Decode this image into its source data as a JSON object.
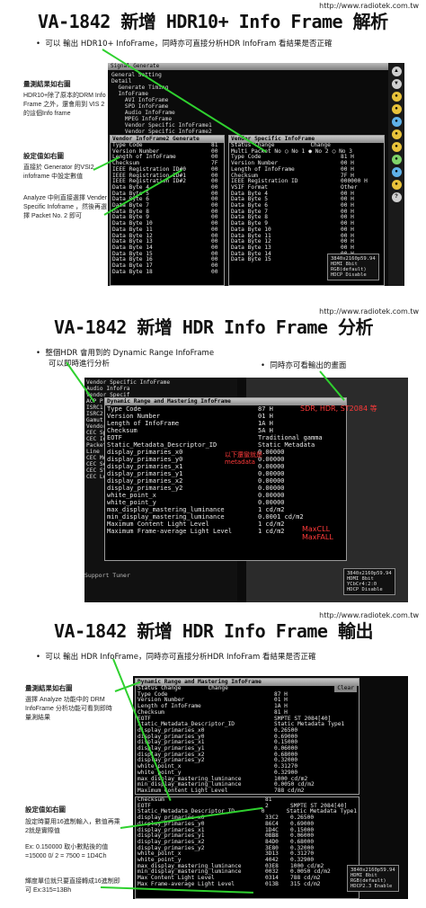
{
  "url": "http://www.radiotek.com.tw",
  "section1": {
    "title": "VA-1842 新增 HDR10+ Info Frame 解析",
    "bullet": "可以 輸出 HDR10+ InfoFrame，同時亦可直接分析HDR InfoFram 看結果是否正確",
    "side_head1": "量測結果如右圖",
    "side_text1": "HDR10+除了原本的DRM Info Frame 之外，還會用到 VIS 2 的這個Info frame",
    "side_head2": "設定值如右圖",
    "side_text2a": "直接於 Generator 的VSI2 infoframe 中設定數值",
    "side_text2b": "Analyze 中則直接選擇 Vender Specific Infoframe ，然後再選擇 Packet No. 2 即可",
    "window_title": "Signal Generate",
    "menu": [
      "General Setting",
      "Detail",
      "  Generate Timing",
      "  InfoFrame",
      "    AVI InfoFrame",
      "    SPD InfoFrame",
      "    Audio InfoFrame",
      "    MPEG InfoFrame",
      "    Vendor Specific InfoFrame1",
      "    Vendor Specific InfoFrame2"
    ],
    "left_pane": {
      "header": "Vendor InfoFrame2 Generate",
      "rows": [
        [
          "Type Code",
          "81"
        ],
        [
          "Version Number",
          "00"
        ],
        [
          "Length of InfoFrame",
          "00"
        ],
        [
          "Checksum",
          "7F"
        ],
        [
          "IEEE Registration ID#0",
          "00"
        ],
        [
          "IEEE Registration ID#1",
          "00"
        ],
        [
          "IEEE Registration ID#2",
          "00"
        ],
        [
          "Data Byte 4",
          "00"
        ],
        [
          "Data Byte 5",
          "00"
        ],
        [
          "Data Byte 6",
          "00"
        ],
        [
          "Data Byte 7",
          "00"
        ],
        [
          "Data Byte 8",
          "00"
        ],
        [
          "Data Byte 9",
          "00"
        ],
        [
          "Data Byte 10",
          "00"
        ],
        [
          "Data Byte 11",
          "00"
        ],
        [
          "Data Byte 12",
          "00"
        ],
        [
          "Data Byte 13",
          "00"
        ],
        [
          "Data Byte 14",
          "00"
        ],
        [
          "Data Byte 15",
          "00"
        ],
        [
          "Data Byte 16",
          "00"
        ],
        [
          "Data Byte 17",
          "00"
        ],
        [
          "Data Byte 18",
          "00"
        ]
      ]
    },
    "right_pane": {
      "header": "Vendor Specific InfoFrame",
      "status_change": "Status Change",
      "change": "Change",
      "multi_packet": "Multi Packet No",
      "no1": "No 1",
      "no2": "No 2",
      "no3": "No 3",
      "rows": [
        [
          "Type Code",
          "81 H"
        ],
        [
          "Version Number",
          "00 H"
        ],
        [
          "Length of InfoFrame",
          "00 H"
        ],
        [
          "Checksum",
          "7F H"
        ],
        [
          "IEEE Registration ID",
          "000000 H"
        ],
        [
          "VSIF Format",
          "Other"
        ],
        [
          "Data Byte 4",
          "00 H"
        ],
        [
          "Data Byte 5",
          "00 H"
        ],
        [
          "Data Byte 6",
          "00 H"
        ],
        [
          "Data Byte 7",
          "00 H"
        ],
        [
          "Data Byte 8",
          "00 H"
        ],
        [
          "Data Byte 9",
          "00 H"
        ],
        [
          "Data Byte 10",
          "00 H"
        ],
        [
          "Data Byte 11",
          "00 H"
        ],
        [
          "Data Byte 12",
          "00 H"
        ],
        [
          "Data Byte 13",
          "00 H"
        ],
        [
          "Data Byte 14",
          "00 H"
        ],
        [
          "Data Byte 15",
          "00 H"
        ]
      ]
    },
    "status": "3840x2160p59.94\nHDMI 8bit\nRGB(default)\nHDCP Disable"
  },
  "section2": {
    "title": "VA-1842 新增 HDR Info Frame 分析",
    "bullet1": "整個HDR 會用到的 Dynamic Range InfoFrame",
    "bullet1b": "可以即時進行分析",
    "bullet2": "同時亦可看輸出的畫面",
    "bg_menu": [
      "Audio InfoFra",
      "Vendor Specif",
      "ACP P",
      "ISRC1",
      "ISRC2",
      "Gamut",
      "Vendor Specific InfoFra",
      "CEC Sp",
      "CEC Ide",
      "Packet",
      "Line",
      "CEC Mon",
      "CEC Sen",
      "CEC Sta",
      "CEC Lo"
    ],
    "bg_menu_top": "Vendor Specific InfoFrame",
    "pane_header": "Dynamic Range and Mastering InfoFrame",
    "rows": [
      [
        "Type Code",
        "87 H"
      ],
      [
        "Version Number",
        "01 H"
      ],
      [
        "Length of InfoFrame",
        "1A H"
      ],
      [
        "Checksum",
        "5A H"
      ],
      [
        "EOTF",
        "Traditional gamma"
      ],
      [
        "Static_Metadata_Descriptor_ID",
        "Static Metadata"
      ],
      [
        "display_primaries_x0",
        "0.00000"
      ],
      [
        "display_primaries_y0",
        "0.00000"
      ],
      [
        "display_primaries_x1",
        "0.00000"
      ],
      [
        "display_primaries_y1",
        "0.00000"
      ],
      [
        "display_primaries_x2",
        "0.00000"
      ],
      [
        "display_primaries_y2",
        "0.00000"
      ],
      [
        "white_point_x",
        "0.00000"
      ],
      [
        "white_point_y",
        "0.00000"
      ],
      [
        "max_display_mastering_luminance",
        "1 cd/m2"
      ],
      [
        "min_display_mastering_luminance",
        "0.0001 cd/m2"
      ],
      [
        "Maximum Content Light Level",
        "1 cd/m2"
      ],
      [
        "Maximum Frame-average Light Level",
        "1 cd/m2"
      ]
    ],
    "note_eotf": "SDR, HDR, ST2084 等",
    "note_metadata": "以下還蠻就是metadata",
    "note_maxcll": "MaxCLL",
    "note_maxfall": "MaxFALL",
    "support_tuner": "Support Tuner",
    "status": "3840x2160p59.94\nHDMI 8bit\nYCbCr4:2:0\nHDCP Disable"
  },
  "section3": {
    "title": "VA-1842 新增 HDR Info Frame 輸出",
    "bullet": "可以 輸出 HDR InfoFrame，同時亦可直接分析HDR InfoFram 看結果是否正確",
    "side_head1": "量測結果如右圖",
    "side_text1": "選擇 Analyze 功能中的 DRM InfoFrame 分析功能可看到即時量測結果",
    "side_head2": "設定值如右圖",
    "side_text2": "設定時要用16進制輸入，數值再乘2就是實際值",
    "side_text3": "Ex: 0.150000 取小數點後的值=15000 0/ 2 = 7500 = 1D4Ch",
    "side_text4": "輝度單位就只要直接轉成16進制即可 Ex:315=13Bh",
    "top_pane": {
      "header": "Dynamic Range and Mastering InfoFrame",
      "status_change": "Status Change",
      "change": "Change",
      "clear": "Clear",
      "rows": [
        [
          "Type Code",
          "87 H"
        ],
        [
          "Version Number",
          "01 H"
        ],
        [
          "Length of InfoFrame",
          "1A H"
        ],
        [
          "Checksum",
          "81 H"
        ],
        [
          "EOTF",
          "SMPTE ST 2084[40]"
        ],
        [
          "Static_Metadata_Descriptor_ID",
          "Static Metadata Type1"
        ],
        [
          "display_primaries_x0",
          "0.26500"
        ],
        [
          "display_primaries_y0",
          "0.69000"
        ],
        [
          "display_primaries_x1",
          "0.15000"
        ],
        [
          "display_primaries_y1",
          "0.06000"
        ],
        [
          "display_primaries_x2",
          "0.68000"
        ],
        [
          "display_primaries_y2",
          "0.32000"
        ],
        [
          "white_point_x",
          "0.31270"
        ],
        [
          "white_point_y",
          "0.32900"
        ],
        [
          "max_display_mastering_luminance",
          "1000 cd/m2"
        ],
        [
          "min_display_mastering_luminance",
          "0.0050 cd/m2"
        ],
        [
          "Maximum Content Light Level",
          "788 cd/m2"
        ],
        [
          "Maximum Frame-average Light Level",
          "315 cd/m2"
        ]
      ]
    },
    "bottom_pane": {
      "rows": [
        [
          "Checksum",
          "81",
          "",
          ""
        ],
        [
          "EOTF",
          "2",
          "SMPTE ST 2084[40]",
          ""
        ],
        [
          "Static_Metadata_Descriptor_ID",
          "0",
          "Static Metadata Type1",
          ""
        ],
        [
          "display_primaries_x0",
          "33C2",
          "0.26500",
          ""
        ],
        [
          "display_primaries_y0",
          "86C4",
          "0.69000",
          ""
        ],
        [
          "display_primaries_x1",
          "1D4C",
          "0.15000",
          ""
        ],
        [
          "display_primaries_y1",
          "0BB8",
          "0.06000",
          ""
        ],
        [
          "display_primaries_x2",
          "84D0",
          "0.68000",
          ""
        ],
        [
          "display_primaries_y2",
          "3E80",
          "0.32000",
          ""
        ],
        [
          "white_point_x",
          "3D13",
          "0.31270",
          ""
        ],
        [
          "white_point_y",
          "4042",
          "0.32900",
          ""
        ],
        [
          "max_display_mastering_luminance",
          "03E8",
          "1000 cd/m2",
          ""
        ],
        [
          "min_display_mastering_luminance",
          "0032",
          "0.0050 cd/m2",
          ""
        ],
        [
          "Max Content Light Level",
          "0314",
          "788 cd/m2",
          ""
        ],
        [
          "Max Frame-average Light Level",
          "013B",
          "315 cd/m2",
          ""
        ]
      ]
    },
    "status": "3840x2160p59.94\nHDMI 8bit\nRGB(default)\nHDCP2.3 Enable"
  },
  "colors": {
    "arrow": "#2fd12f",
    "note": "#ff3a3a"
  }
}
